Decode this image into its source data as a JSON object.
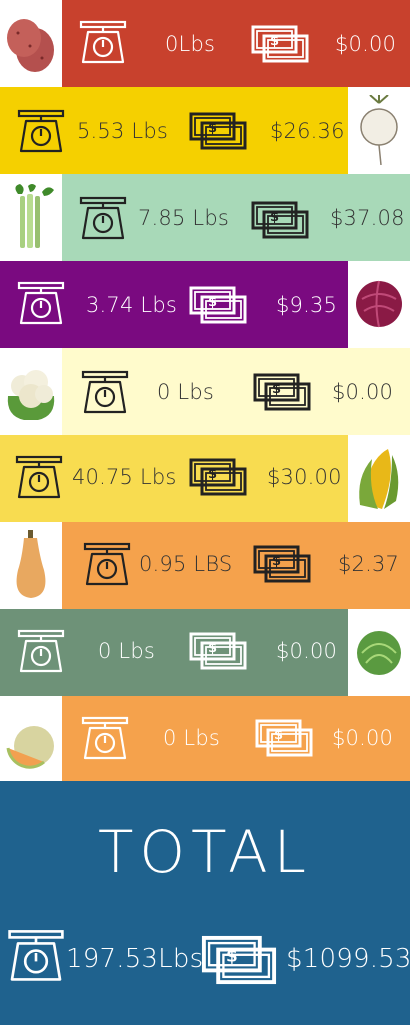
{
  "colors": {
    "potato": "#c8412d",
    "turnip": "#f5d000",
    "celery": "#a8d9b8",
    "cabbage": "#7a0a80",
    "cauliflower": "#fffbcc",
    "corn": "#f8dc50",
    "squash": "#f5a24c",
    "brussels": "#6e9278",
    "melon": "#f5a24c",
    "total": "#1f628e"
  },
  "rows": [
    {
      "produce": "potato-icon",
      "weight": "0Lbs",
      "amount": "$0.00"
    },
    {
      "produce": "turnip-icon",
      "weight": "5.53 Lbs",
      "amount": "$26.36"
    },
    {
      "produce": "celery-icon",
      "weight": "7.85 Lbs",
      "amount": "$37.08"
    },
    {
      "produce": "red-cabbage-icon",
      "weight": "3.74 Lbs",
      "amount": "$9.35"
    },
    {
      "produce": "cauliflower-icon",
      "weight": "0 Lbs",
      "amount": "$0.00"
    },
    {
      "produce": "corn-icon",
      "weight": "40.75 Lbs",
      "amount": "$30.00"
    },
    {
      "produce": "butternut-squash-icon",
      "weight": "0.95 LBS",
      "amount": "$2.37"
    },
    {
      "produce": "brussels-sprout-icon",
      "weight": "0 Lbs",
      "amount": "$0.00"
    },
    {
      "produce": "cantaloupe-icon",
      "weight": "0 Lbs",
      "amount": "$0.00"
    }
  ],
  "total": {
    "title": "TOTAL",
    "weight": "197.53Lbs",
    "amount": "$1099.53"
  }
}
